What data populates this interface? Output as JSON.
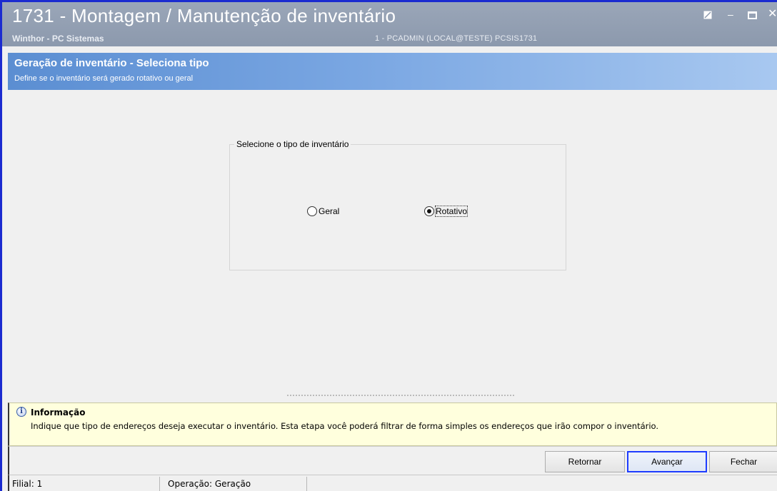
{
  "window": {
    "title": "1731 - Montagem / Manutenção de inventário",
    "subtitle": "Winthor - PC Sistemas",
    "session": "1 - PCADMIN (LOCAL@TESTE)   PCSIS1731",
    "controls": {
      "minimize": "–",
      "close": "✕"
    }
  },
  "step": {
    "title": "Geração de inventário - Seleciona tipo",
    "description": "Define se o inventário será gerado rotativo ou geral"
  },
  "group": {
    "label": "Selecione o tipo de inventário",
    "options": [
      {
        "label": "Geral",
        "checked": false
      },
      {
        "label": "Rotativo",
        "checked": true
      }
    ]
  },
  "info": {
    "icon": "info-icon",
    "icon_glyph": "i",
    "title": "Informação",
    "text": "Indique que tipo de endereços deseja executar o inventário. Esta etapa você poderá filtrar de forma simples os endereços que irão compor o inventário."
  },
  "buttons": {
    "retornar": "Retornar",
    "avancar": "Avançar",
    "fechar": "Fechar"
  },
  "status": {
    "filial": "Filial: 1",
    "operacao": "Operação: Geração"
  },
  "colors": {
    "accent": "#1e3cff",
    "titlebar": "#8c99ad",
    "step_header_start": "#5b8ed2",
    "info_bg": "#ffffdd"
  }
}
